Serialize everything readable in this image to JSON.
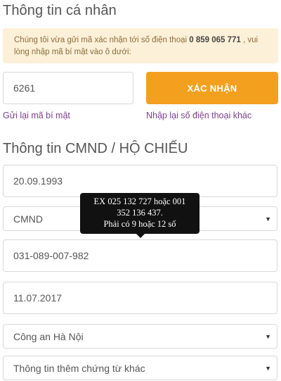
{
  "personal": {
    "title": "Thông tin cá nhân",
    "notice_text": "Chúng tôi vừa gửi mã xác nhận tới số điện thoại ",
    "notice_phone": "0 859 065 771",
    "notice_suffix": " , vui lòng nhập mã bí mật vào ô dưới:",
    "otp_value": "6261",
    "confirm_label": "XÁC NHẬN",
    "resend_link": "Gửi lại mã bí mật",
    "reenter_phone_link": "Nhập lại số điện thoại khác"
  },
  "id_section": {
    "title": "Thông tin CMND / HỘ CHIẾU",
    "dob_value": "20.09.1993",
    "doc_type_value": "CMND",
    "id_number_value": "031-089-007-982",
    "issue_date_value": "11.07.2017",
    "issuer_value": "Công an Hà Nội",
    "other_docs_value": "Thông tin thêm chứng từ khác"
  },
  "tooltip": {
    "line1": "EX 025 132 727 hoặc 001",
    "line2": "352 136 437.",
    "line3": "Phải có 9 hoặc 12 số"
  },
  "colors": {
    "accent": "#f4a01f",
    "notice_bg": "#fdf0d8",
    "link": "#7b3f8c"
  },
  "icons": {
    "select_caret": "caret-down-icon"
  }
}
